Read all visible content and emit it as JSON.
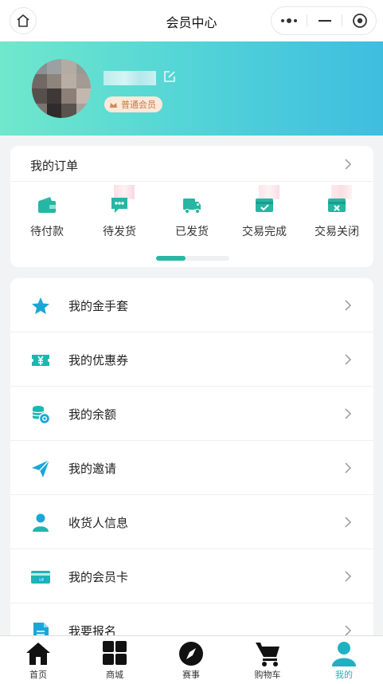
{
  "navbar": {
    "title": "会员中心"
  },
  "profile": {
    "badge": "普通会员"
  },
  "orders": {
    "title": "我的订单",
    "statuses": [
      {
        "label": "待付款",
        "icon": "wallet-icon"
      },
      {
        "label": "待发货",
        "icon": "chat-box-icon"
      },
      {
        "label": "已发货",
        "icon": "delivery-truck-icon"
      },
      {
        "label": "交易完成",
        "icon": "card-check-icon"
      },
      {
        "label": "交易关闭",
        "icon": "card-close-icon"
      }
    ],
    "pager_progress": 0.4
  },
  "menu": [
    {
      "label": "我的金手套",
      "icon": "star-icon"
    },
    {
      "label": "我的优惠券",
      "icon": "coupon-icon"
    },
    {
      "label": "我的余额",
      "icon": "balance-coins-icon"
    },
    {
      "label": "我的邀请",
      "icon": "paper-plane-icon"
    },
    {
      "label": "收货人信息",
      "icon": "person-icon"
    },
    {
      "label": "我的会员卡",
      "icon": "vip-card-icon"
    },
    {
      "label": "我要报名",
      "icon": "document-icon"
    }
  ],
  "tabbar": [
    {
      "label": "首页",
      "icon": "home-icon"
    },
    {
      "label": "商城",
      "icon": "grid-icon"
    },
    {
      "label": "赛事",
      "icon": "compass-icon"
    },
    {
      "label": "购物车",
      "icon": "cart-icon"
    },
    {
      "label": "我的",
      "icon": "person-icon",
      "active": true
    }
  ],
  "colors": {
    "accent": "#25b9a4",
    "header_start": "#6fe8cc",
    "header_end": "#3fbde0",
    "active_tab": "#1fb1c2"
  }
}
